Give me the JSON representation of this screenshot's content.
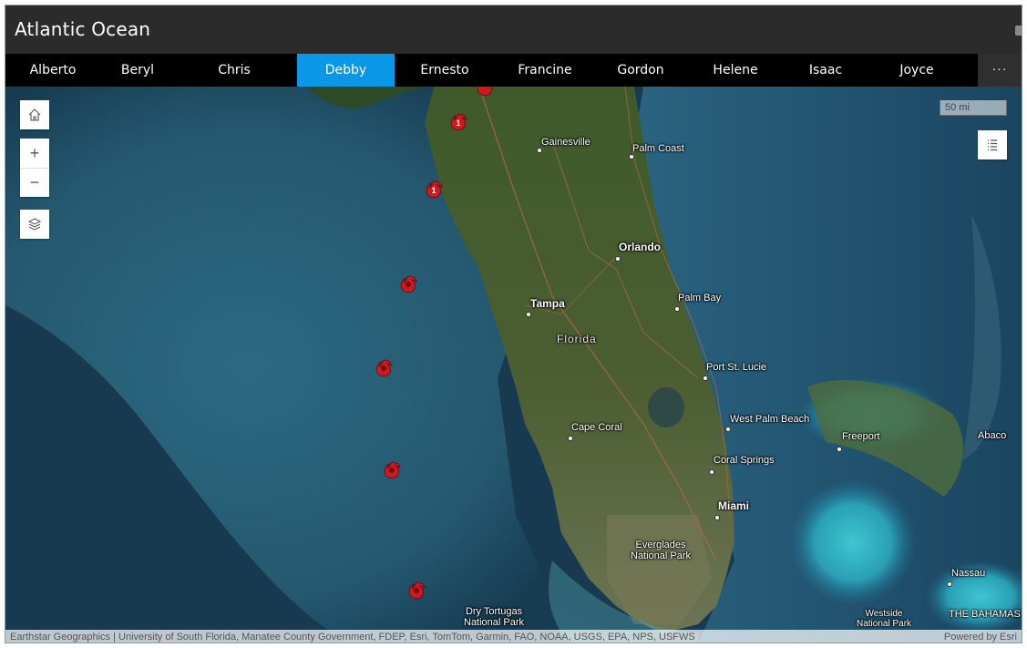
{
  "app": {
    "title": "Atlantic Ocean"
  },
  "tabs": [
    {
      "label": "Alberto",
      "active": false
    },
    {
      "label": "Beryl",
      "active": false
    },
    {
      "label": "Chris",
      "active": false
    },
    {
      "label": "Debby",
      "active": true
    },
    {
      "label": "Ernesto",
      "active": false
    },
    {
      "label": "Francine",
      "active": false
    },
    {
      "label": "Gordon",
      "active": false
    },
    {
      "label": "Helene",
      "active": false
    },
    {
      "label": "Isaac",
      "active": false
    },
    {
      "label": "Joyce",
      "active": false
    }
  ],
  "more_tabs_label": "···",
  "map": {
    "scale_label": "50 mi",
    "controls": {
      "home": "home-icon",
      "zoom_in": "+",
      "zoom_out": "−",
      "layers": "layers-icon",
      "legend": "legend-list-icon"
    },
    "places": {
      "gainesville": "Gainesville",
      "palm_coast": "Palm Coast",
      "orlando": "Orlando",
      "tampa": "Tampa",
      "palm_bay": "Palm Bay",
      "florida": "Florida",
      "port_st_lucie": "Port St. Lucie",
      "west_palm_beach": "West Palm Beach",
      "cape_coral": "Cape Coral",
      "freeport": "Freeport",
      "abaco": "Abaco",
      "coral_springs": "Coral Springs",
      "miami": "Miami",
      "everglades": "Everglades\nNational Park",
      "nassau": "Nassau",
      "dry_tortugas": "Dry Tortugas\nNational Park",
      "westside": "Westside\nNational Park",
      "the_bahamas": "THE BAHAMAS"
    },
    "storm_track": [
      {
        "category": "1",
        "icon": "hurricane-icon"
      },
      {
        "category": "1",
        "icon": "hurricane-icon"
      },
      {
        "category": "",
        "icon": "tropical-storm-icon"
      },
      {
        "category": "",
        "icon": "tropical-storm-icon"
      },
      {
        "category": "",
        "icon": "tropical-storm-icon"
      },
      {
        "category": "",
        "icon": "tropical-storm-icon"
      }
    ],
    "colors": {
      "storm": "#d0191f",
      "active_tab": "#0b97e8",
      "land": "#3f5a2c",
      "sea": "#1f4d64"
    },
    "attribution": "Earthstar Geographics | University of South Florida, Manatee County Government, FDEP, Esri, TomTom, Garmin, FAO, NOAA, USGS, EPA, NPS, USFWS",
    "powered_by": "Powered by Esri"
  }
}
